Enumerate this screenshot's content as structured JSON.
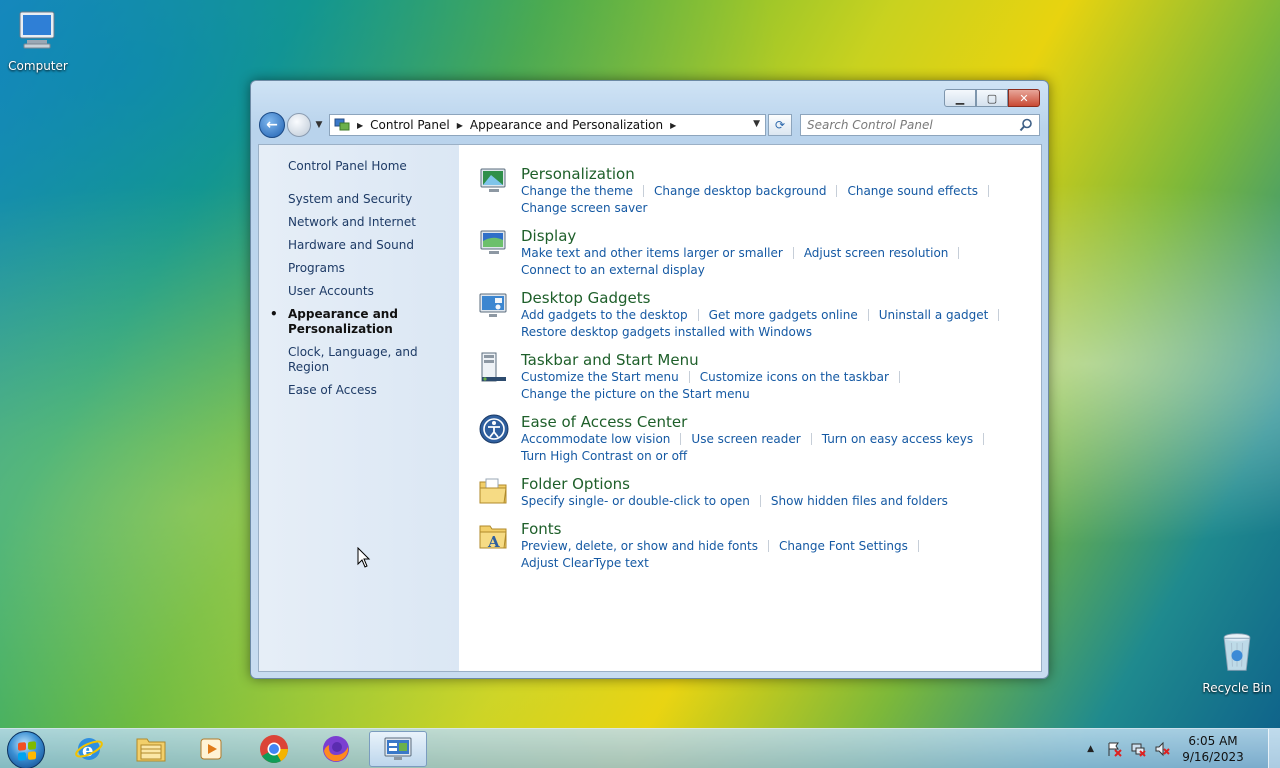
{
  "desktop": {
    "icons": [
      {
        "label": "Computer"
      },
      {
        "label": "Recycle Bin"
      }
    ]
  },
  "window": {
    "address": {
      "crumbs": [
        "Control Panel",
        "Appearance and Personalization"
      ]
    },
    "search": {
      "placeholder": "Search Control Panel"
    },
    "sidebar": {
      "home": "Control Panel Home",
      "items": [
        {
          "label": "System and Security"
        },
        {
          "label": "Network and Internet"
        },
        {
          "label": "Hardware and Sound"
        },
        {
          "label": "Programs"
        },
        {
          "label": "User Accounts"
        },
        {
          "label": "Appearance and Personalization",
          "active": true
        },
        {
          "label": "Clock, Language, and Region"
        },
        {
          "label": "Ease of Access"
        }
      ]
    },
    "categories": [
      {
        "title": "Personalization",
        "icon": "personalization-icon",
        "links": [
          "Change the theme",
          "Change desktop background",
          "Change sound effects",
          "Change screen saver"
        ]
      },
      {
        "title": "Display",
        "icon": "display-icon",
        "links": [
          "Make text and other items larger or smaller",
          "Adjust screen resolution",
          "Connect to an external display"
        ]
      },
      {
        "title": "Desktop Gadgets",
        "icon": "gadgets-icon",
        "links": [
          "Add gadgets to the desktop",
          "Get more gadgets online",
          "Uninstall a gadget",
          "Restore desktop gadgets installed with Windows"
        ]
      },
      {
        "title": "Taskbar and Start Menu",
        "icon": "taskbar-icon",
        "links": [
          "Customize the Start menu",
          "Customize icons on the taskbar",
          "Change the picture on the Start menu"
        ]
      },
      {
        "title": "Ease of Access Center",
        "icon": "ease-of-access-icon",
        "links": [
          "Accommodate low vision",
          "Use screen reader",
          "Turn on easy access keys",
          "Turn High Contrast on or off"
        ]
      },
      {
        "title": "Folder Options",
        "icon": "folder-options-icon",
        "links": [
          "Specify single- or double-click to open",
          "Show hidden files and folders"
        ]
      },
      {
        "title": "Fonts",
        "icon": "fonts-icon",
        "links": [
          "Preview, delete, or show and hide fonts",
          "Change Font Settings",
          "Adjust ClearType text"
        ]
      }
    ]
  },
  "taskbar": {
    "apps": [
      "internet-explorer-icon",
      "file-explorer-icon",
      "media-player-icon",
      "chrome-icon",
      "firefox-icon",
      "control-panel-icon"
    ],
    "clock": {
      "time": "6:05 AM",
      "date": "9/16/2023"
    }
  },
  "colors": {
    "category_title": "#1e5f2a",
    "link": "#1559a3",
    "sidebar_text": "#1e3b66"
  }
}
